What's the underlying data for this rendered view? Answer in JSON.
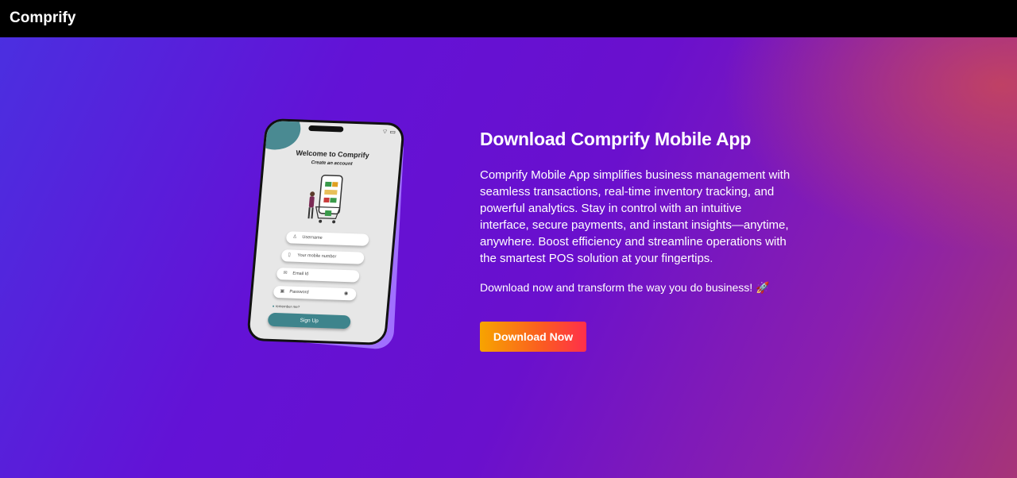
{
  "navbar": {
    "brand": "Comprify"
  },
  "phone": {
    "title": "Welcome to Comprify",
    "subtitle": "Create an account",
    "fields": {
      "username": "Username",
      "mobile": "Your mobile number",
      "email": "Email Id",
      "password": "Password"
    },
    "remember": "remember me?",
    "signup": "Sign Up"
  },
  "main": {
    "title": "Download Comprify Mobile App",
    "description": "Comprify Mobile App simplifies business management with seamless transactions, real-time inventory tracking, and powerful analytics. Stay in control with an intuitive interface, secure payments, and instant insights—anytime, anywhere. Boost efficiency and streamline operations with the smartest POS solution at your fingertips.",
    "cta_text": "Download now and transform the way you do business! 🚀",
    "download_label": "Download Now"
  },
  "colors": {
    "navbar": "#000000",
    "button_start": "#f7a400",
    "button_end": "#ff2f4b",
    "phone_accent": "#3e848c"
  }
}
